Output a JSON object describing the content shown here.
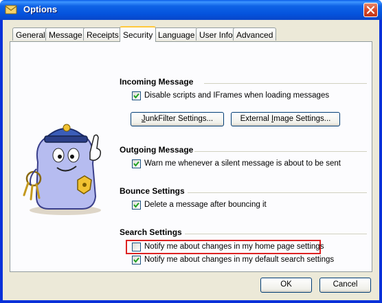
{
  "window": {
    "title": "Options"
  },
  "tabs": [
    {
      "label": "General"
    },
    {
      "label": "Message"
    },
    {
      "label": "Receipts"
    },
    {
      "label": "Security",
      "active": true
    },
    {
      "label": "Language"
    },
    {
      "label": "User Info"
    },
    {
      "label": "Advanced"
    }
  ],
  "sections": {
    "incoming": {
      "title": "Incoming Message",
      "checkbox_label": "Disable scripts and IFrames when loading messages",
      "checked": true,
      "junk_button_prefix": "J",
      "junk_button_rest": "unkFilter Settings...",
      "external_button_prefix": "External ",
      "external_button_underline": "I",
      "external_button_rest": "mage Settings..."
    },
    "outgoing": {
      "title": "Outgoing Message",
      "checkbox_label": "Warn me whenever a silent message is about to be sent",
      "checked": true
    },
    "bounce": {
      "title": "Bounce Settings",
      "checkbox_label": "Delete a message after bouncing it",
      "checked": true
    },
    "search": {
      "title": "Search Settings",
      "home_label": "Notify me about changes in my home page settings",
      "home_checked": false,
      "default_label": "Notify me about changes in my default search settings",
      "default_checked": true
    }
  },
  "footer": {
    "ok_label": "OK",
    "cancel_label": "Cancel"
  }
}
